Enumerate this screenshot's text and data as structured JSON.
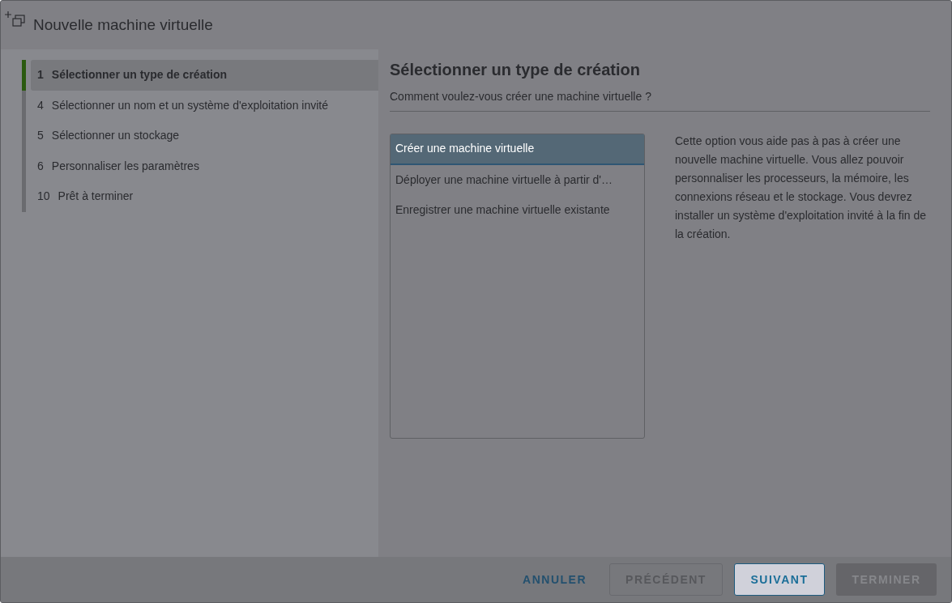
{
  "window": {
    "title": "Nouvelle machine virtuelle"
  },
  "steps": [
    {
      "number": "1",
      "label": "Sélectionner un type de création",
      "selected": true
    },
    {
      "number": "4",
      "label": "Sélectionner un nom et un système d'exploitation invité",
      "selected": false
    },
    {
      "number": "5",
      "label": "Sélectionner un stockage",
      "selected": false
    },
    {
      "number": "6",
      "label": "Personnaliser les paramètres",
      "selected": false
    },
    {
      "number": "10",
      "label": "Prêt à terminer",
      "selected": false
    }
  ],
  "page": {
    "heading": "Sélectionner un type de création",
    "subtitle": "Comment voulez-vous créer une machine virtuelle ?",
    "options": [
      {
        "label": "Créer une machine virtuelle",
        "selected": true
      },
      {
        "label": "Déployer une machine virtuelle à partir d'…",
        "selected": false
      },
      {
        "label": "Enregistrer une machine virtuelle existante",
        "selected": false
      }
    ],
    "description": "Cette option vous aide pas à pas à créer une nouvelle machine virtuelle. Vous allez pouvoir personnaliser les processeurs, la mémoire, les connexions réseau et le stockage. Vous devrez installer un système d'exploitation invité à la fin de la création."
  },
  "buttons": [
    {
      "label": "ANNULER",
      "kind": "link",
      "disabled": false
    },
    {
      "label": "PRÉCÉDENT",
      "kind": "outline",
      "disabled": true
    },
    {
      "label": "SUIVANT",
      "kind": "primary",
      "disabled": false
    },
    {
      "label": "TERMINER",
      "kind": "solid",
      "disabled": true
    }
  ]
}
